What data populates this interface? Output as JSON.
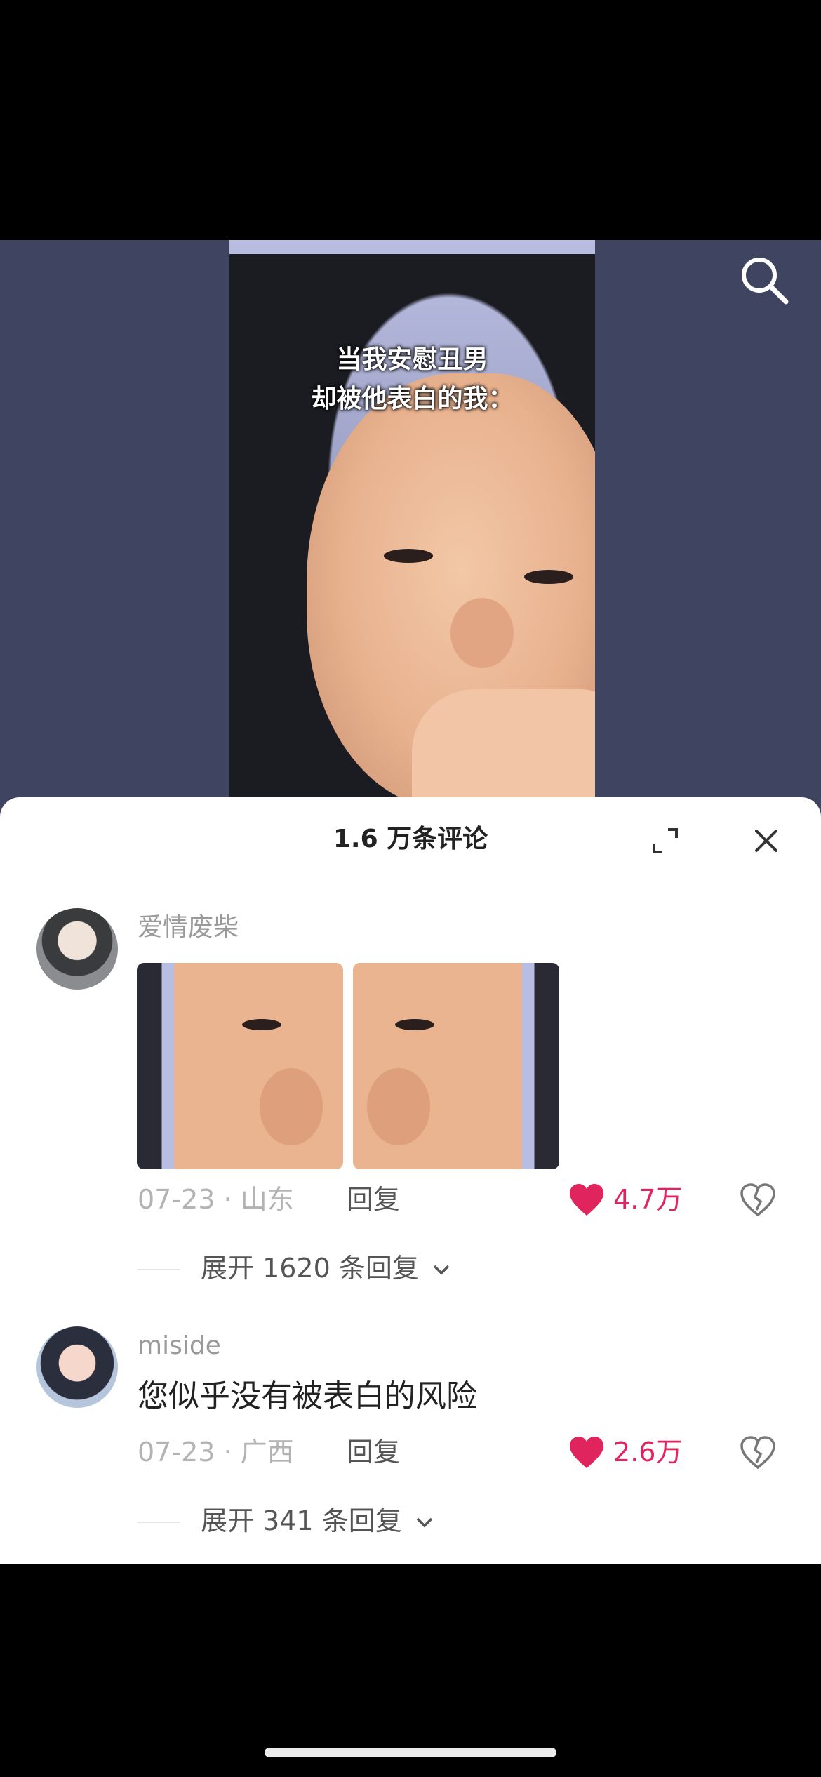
{
  "video": {
    "caption_line1": "当我安慰丑男",
    "caption_line2": "却被他表白的我："
  },
  "comments_panel": {
    "title": "1.6 万条评论"
  },
  "comments": [
    {
      "username": "爱情废柴",
      "text": "",
      "date": "07-23",
      "location": "山东",
      "reply_label": "回复",
      "likes": "4.7万",
      "expand_replies": "展开 1620 条回复"
    },
    {
      "username": "miside",
      "text": "您似乎没有被表白的风险",
      "date": "07-23",
      "location": "广西",
      "reply_label": "回复",
      "likes": "2.6万",
      "expand_replies": "展开 341 条回复"
    }
  ],
  "colors": {
    "like": "#e0245e",
    "sheet_bg": "#ffffff",
    "video_bg": "#3f4560"
  },
  "icons": [
    "search-icon",
    "expand-icon",
    "close-icon",
    "heart-icon",
    "broken-heart-icon",
    "chevron-down-icon"
  ]
}
